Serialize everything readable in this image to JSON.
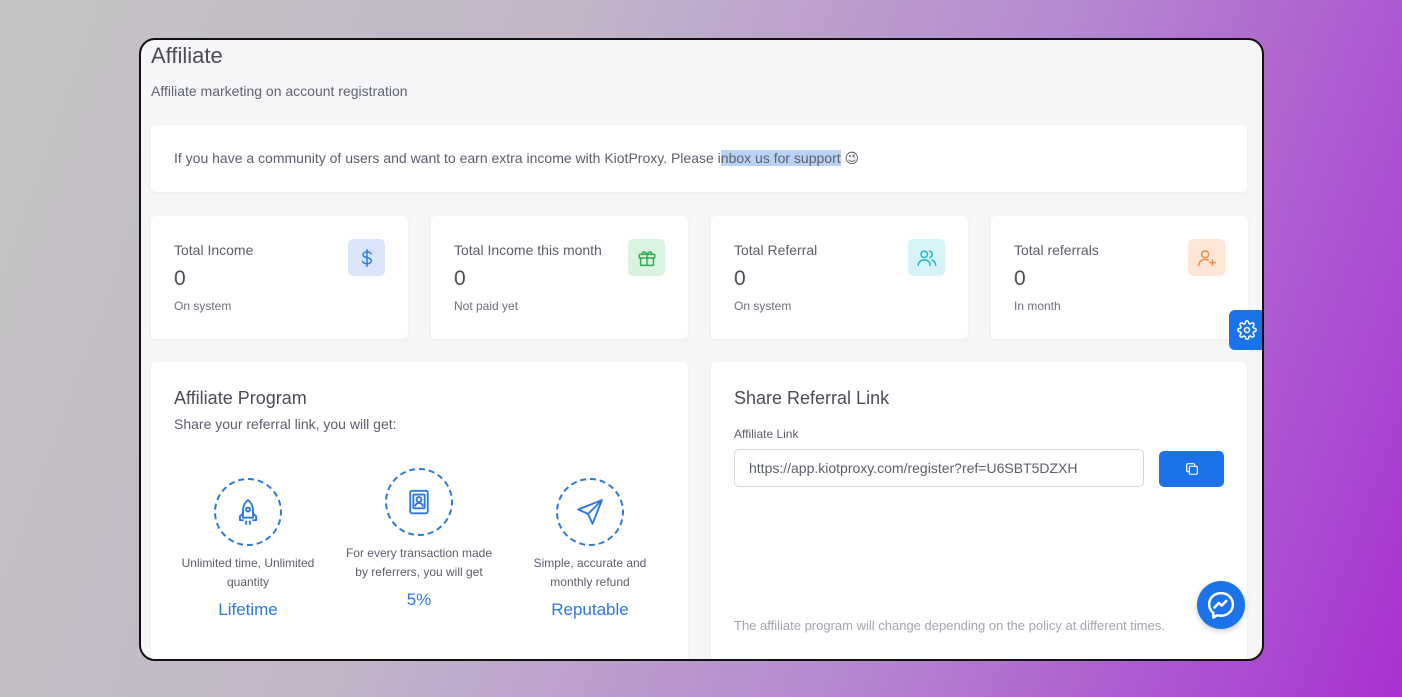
{
  "header": {
    "title": "Affiliate",
    "subtitle": "Affiliate marketing on account registration"
  },
  "notice": {
    "text_before": "If you have a community of users and want to earn extra income with KiotProxy. Please i",
    "text_highlight": "nbox us for support",
    "emoji": "😉"
  },
  "stats": [
    {
      "label": "Total Income",
      "value": "0",
      "sub": "On system",
      "icon": "dollar-icon",
      "icon_color": "#2c79df",
      "icon_bg": "#dbe6fb"
    },
    {
      "label": "Total Income this month",
      "value": "0",
      "sub": "Not paid yet",
      "icon": "gift-icon",
      "icon_color": "#2cb04f",
      "icon_bg": "#d9f3e0"
    },
    {
      "label": "Total Referral",
      "value": "0",
      "sub": "On system",
      "icon": "users-icon",
      "icon_color": "#1fb5c9",
      "icon_bg": "#d6f4f7"
    },
    {
      "label": "Total referrals",
      "value": "0",
      "sub": "In month",
      "icon": "user-plus-icon",
      "icon_color": "#f08a3c",
      "icon_bg": "#fde6d6"
    }
  ],
  "program": {
    "title": "Affiliate Program",
    "description": "Share your referral link, you will get:",
    "features": [
      {
        "icon": "rocket-icon",
        "description": "Unlimited time, Unlimited quantity",
        "value": "Lifetime"
      },
      {
        "icon": "id-badge-icon",
        "description": "For every transaction made by referrers, you will get",
        "value": "5%"
      },
      {
        "icon": "send-icon",
        "description": "Simple, accurate and monthly refund",
        "value": "Reputable"
      }
    ]
  },
  "share": {
    "title": "Share Referral Link",
    "field_label": "Affiliate Link",
    "link_value": "https://app.kiotproxy.com/register?ref=U6SBT5DZXH",
    "note": "The affiliate program will change depending on the policy at different times."
  },
  "colors": {
    "accent": "#1a73e8",
    "highlight": "#b9d3f5"
  }
}
